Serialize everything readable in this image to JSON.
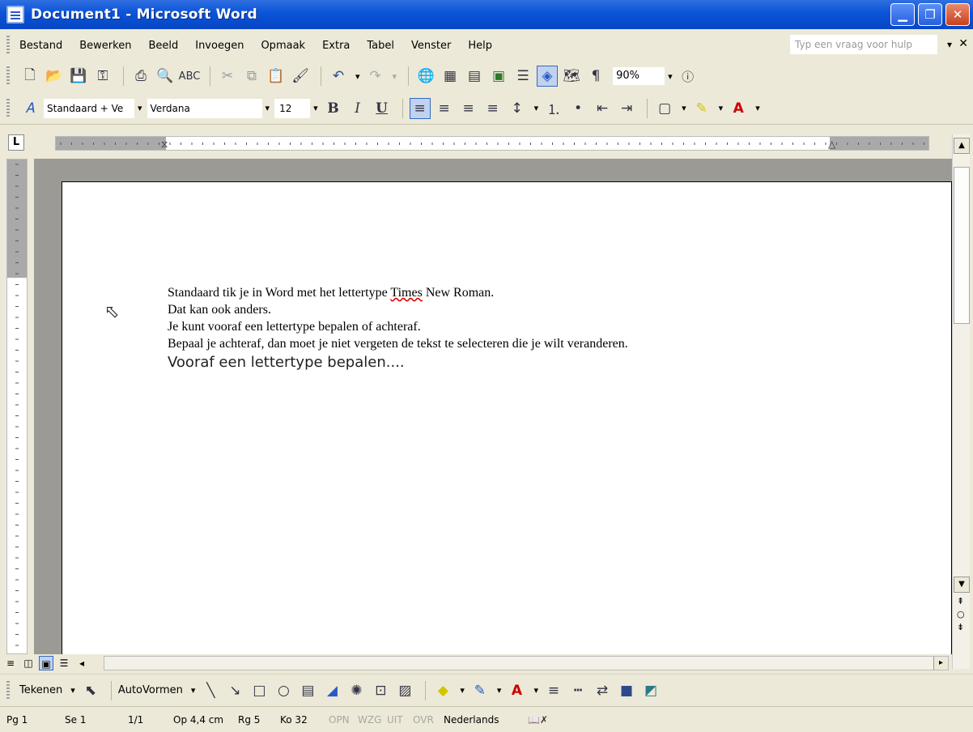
{
  "window": {
    "title": "Document1 - Microsoft Word"
  },
  "menu": {
    "items": [
      "Bestand",
      "Bewerken",
      "Beeld",
      "Invoegen",
      "Opmaak",
      "Extra",
      "Tabel",
      "Venster",
      "Help"
    ],
    "help_placeholder": "Typ een vraag voor hulp"
  },
  "toolbar": {
    "zoom": "90%"
  },
  "format": {
    "style": "Standaard + Ve",
    "font": "Verdana",
    "size": "12",
    "bold": "B",
    "italic": "I",
    "underline": "U"
  },
  "document": {
    "lines": [
      {
        "before": "Standaard tik je in Word met het lettertype ",
        "spell": "Times",
        "after": " New Roman."
      },
      {
        "text": "Dat kan ook anders."
      },
      {
        "text": "Je kunt vooraf een lettertype bepalen of achteraf."
      },
      {
        "text": "Bepaal je achteraf, dan moet je niet vergeten de tekst te selecteren die je wilt veranderen."
      },
      {
        "text": "Vooraf een lettertype bepalen...."
      }
    ]
  },
  "draw": {
    "tekenen": "Tekenen",
    "autovormen": "AutoVormen"
  },
  "status": {
    "page": "Pg 1",
    "section": "Se 1",
    "pages": "1/1",
    "at": "Op 4,4 cm",
    "line": "Rg 5",
    "col": "Ko 32",
    "rec": "OPN",
    "trk": "WZG",
    "ext": "UIT",
    "ovr": "OVR",
    "language": "Nederlands"
  }
}
